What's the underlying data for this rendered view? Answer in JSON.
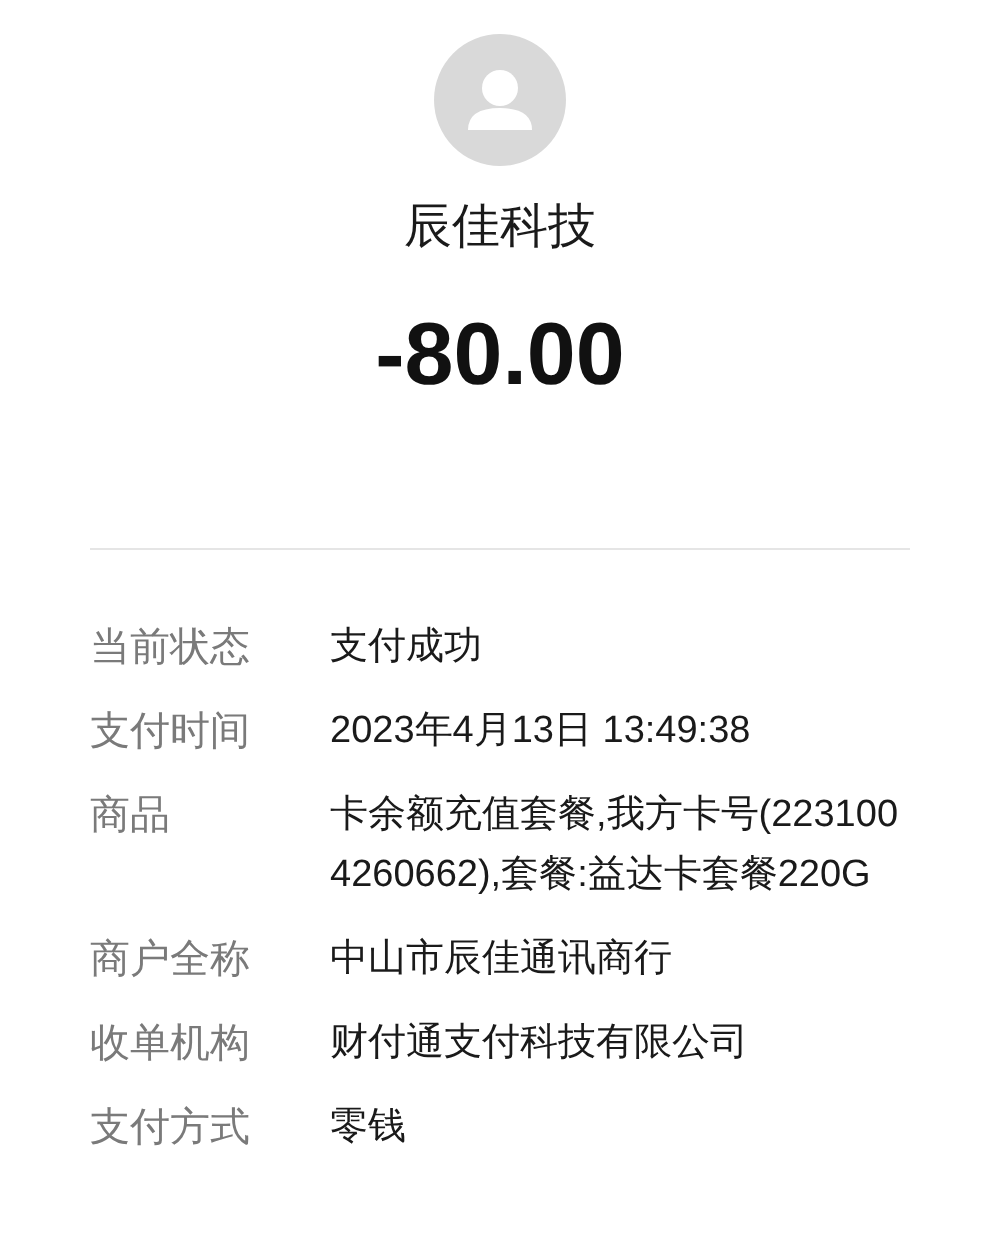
{
  "merchant": {
    "name": "辰佳科技",
    "amount": "-80.00"
  },
  "details": [
    {
      "label": "当前状态",
      "value": "支付成功"
    },
    {
      "label": "支付时间",
      "value": "2023年4月13日 13:49:38"
    },
    {
      "label": "商品",
      "value": "卡余额充值套餐,我方卡号(2231004260662),套餐:益达卡套餐220G"
    },
    {
      "label": "商户全称",
      "value": "中山市辰佳通讯商行"
    },
    {
      "label": "收单机构",
      "value": "财付通支付科技有限公司"
    },
    {
      "label": "支付方式",
      "value": "零钱"
    }
  ]
}
